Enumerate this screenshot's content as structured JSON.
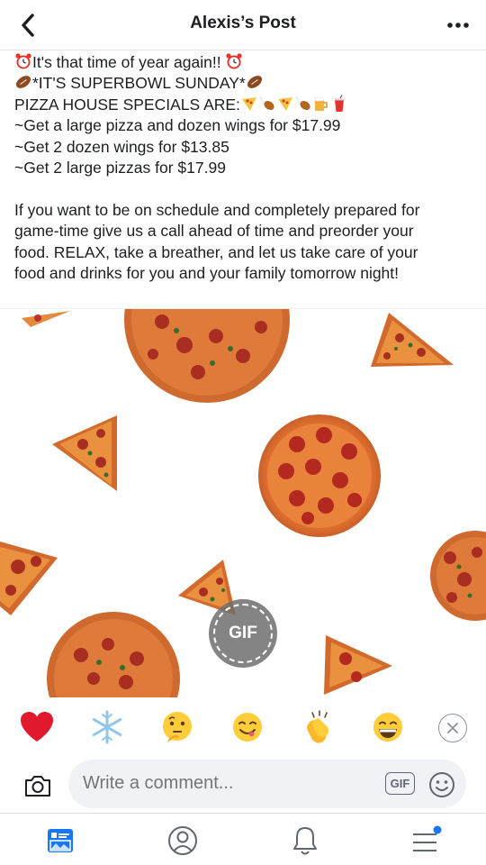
{
  "header": {
    "title": "Alexis’s Post"
  },
  "post": {
    "line1": "It's that time of year again!!",
    "line2": "*IT'S SUPERBOWL SUNDAY*",
    "line3": "PIZZA HOUSE SPECIALS ARE:",
    "specials": [
      "~Get a large pizza and dozen wings for $17.99",
      "~Get 2 dozen wings for $13.85",
      "~Get 2 large pizzas for $17.99"
    ],
    "paragraph_lines": [
      "If you want to be on schedule and completely prepared for",
      "game-time give us a call ahead of time and preorder your",
      "food. RELAX, take a breather, and let us take care of your",
      "food and drinks for you and your family tomorrow night!"
    ]
  },
  "gif": {
    "badge_label": "GIF"
  },
  "reactions": [
    "heart",
    "snowflake",
    "thinking-face",
    "yum-face",
    "clapping-hands",
    "grinning-face"
  ],
  "comment": {
    "placeholder": "Write a comment...",
    "gif_label": "GIF"
  },
  "icons": {
    "back": "chevron-left-icon",
    "more": "more-dots-icon",
    "camera": "camera-icon",
    "smile": "smiley-icon",
    "tabs": [
      "news-feed-icon",
      "profile-icon",
      "notifications-icon",
      "menu-icon"
    ]
  },
  "colors": {
    "accent": "#1877f2",
    "text": "#1c1e21",
    "muted": "#606770",
    "heart": "#e0192c"
  }
}
